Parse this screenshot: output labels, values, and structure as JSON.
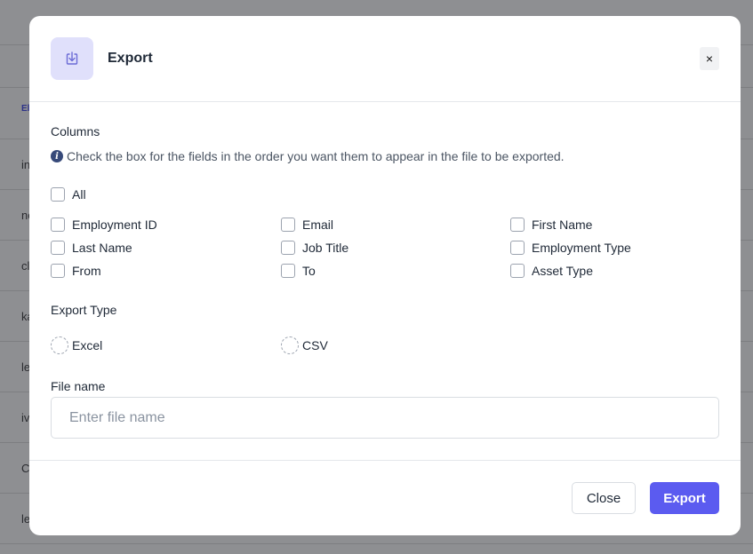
{
  "background": {
    "header_cell": "El",
    "rows": [
      "in",
      "ne",
      "cl",
      "ka",
      "le",
      "iv",
      "C",
      "le"
    ]
  },
  "modal": {
    "title": "Export",
    "icon": "download-tray-icon",
    "close_glyph": "×",
    "columns": {
      "label": "Columns",
      "info_text": "Check the box for the fields in the order you want them to appear in the file to be exported.",
      "all_label": "All",
      "fields": [
        {
          "label": "Employment ID",
          "checked": false
        },
        {
          "label": "Email",
          "checked": false
        },
        {
          "label": "First Name",
          "checked": false
        },
        {
          "label": "Last Name",
          "checked": false
        },
        {
          "label": "Job Title",
          "checked": false
        },
        {
          "label": "Employment Type",
          "checked": false
        },
        {
          "label": "From",
          "checked": false
        },
        {
          "label": "To",
          "checked": false
        },
        {
          "label": "Asset Type",
          "checked": false
        }
      ]
    },
    "export_type": {
      "label": "Export Type",
      "options": [
        {
          "label": "Excel",
          "selected": false
        },
        {
          "label": "CSV",
          "selected": false
        }
      ]
    },
    "file_name": {
      "label": "File name",
      "value": "",
      "placeholder": "Enter file name"
    },
    "footer": {
      "close_label": "Close",
      "export_label": "Export"
    }
  },
  "colors": {
    "accent": "#5b5bf0",
    "icon_bg": "#e0e0fb",
    "overlay": "#8e8f92"
  }
}
